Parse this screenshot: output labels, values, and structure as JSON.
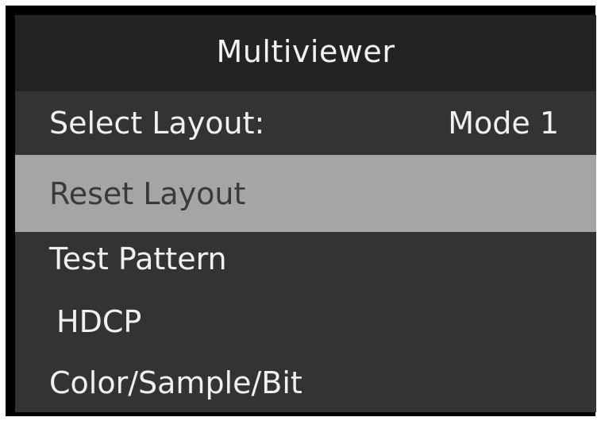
{
  "window": {
    "title": "Multiviewer"
  },
  "menu": {
    "items": [
      {
        "label": "Select Layout:",
        "value": "Mode 1"
      },
      {
        "label": "Reset Layout",
        "selected": true
      },
      {
        "label": "Test Pattern"
      },
      {
        "label": "HDCP"
      },
      {
        "label": "Color/Sample/Bit"
      }
    ]
  },
  "colors": {
    "frame": "#000000",
    "title_bg": "#232323",
    "menu_bg": "#333333",
    "highlight_bg": "#a5a5a5",
    "text": "#f0f0f0",
    "highlight_text": "#3a3a3a"
  }
}
